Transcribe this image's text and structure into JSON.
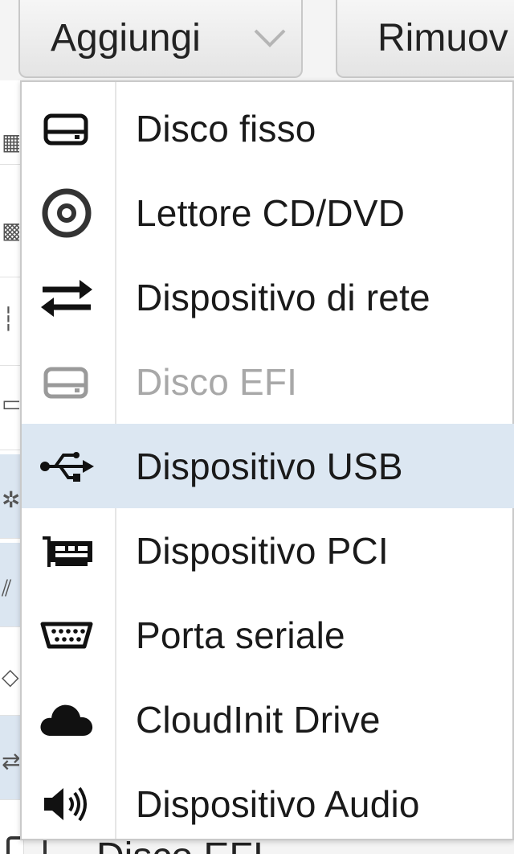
{
  "toolbar": {
    "add_label": "Aggiungi",
    "remove_label": "Rimuov"
  },
  "menu": {
    "items": [
      {
        "label": "Disco fisso",
        "icon": "hard-disk-icon",
        "enabled": true,
        "highlighted": false
      },
      {
        "label": "Lettore CD/DVD",
        "icon": "cd-dvd-icon",
        "enabled": true,
        "highlighted": false
      },
      {
        "label": "Dispositivo di rete",
        "icon": "network-exchange-icon",
        "enabled": true,
        "highlighted": false
      },
      {
        "label": "Disco EFI",
        "icon": "efi-disk-icon",
        "enabled": false,
        "highlighted": false
      },
      {
        "label": "Dispositivo USB",
        "icon": "usb-icon",
        "enabled": true,
        "highlighted": true
      },
      {
        "label": "Dispositivo PCI",
        "icon": "pci-card-icon",
        "enabled": true,
        "highlighted": false
      },
      {
        "label": "Porta seriale",
        "icon": "serial-port-icon",
        "enabled": true,
        "highlighted": false
      },
      {
        "label": "CloudInit Drive",
        "icon": "cloud-icon",
        "enabled": true,
        "highlighted": false
      },
      {
        "label": "Dispositivo Audio",
        "icon": "speaker-icon",
        "enabled": true,
        "highlighted": false
      }
    ]
  },
  "background": {
    "partial_row_label": "Disco EFI"
  },
  "colors": {
    "highlight": "#dce7f2",
    "disabled_text": "#a8a8a8",
    "button_border": "#c8c8c8"
  }
}
